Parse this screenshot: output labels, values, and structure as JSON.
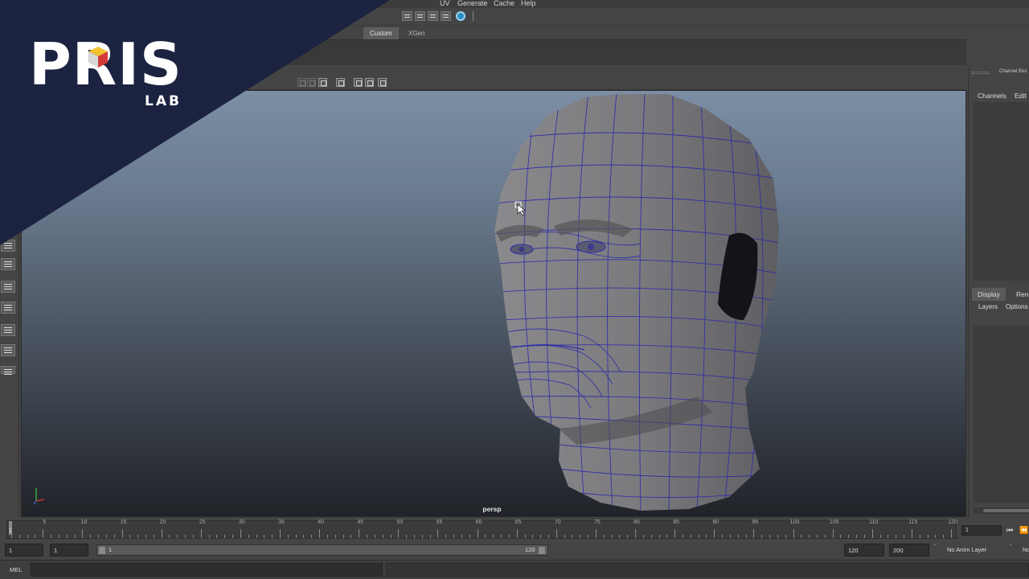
{
  "menu": [
    "UV",
    "Generate",
    "Cache",
    "Help"
  ],
  "shelf_tabs": [
    "Custom",
    "XGen"
  ],
  "shelf_active_tab": "Custom",
  "viewport": {
    "camera": "persp"
  },
  "channel_box": {
    "title": "Channel Box",
    "menus": [
      "Channels",
      "Edit"
    ]
  },
  "layer_editor": {
    "tabs": [
      "Display",
      "Rend"
    ],
    "menus": [
      "Layers",
      "Options"
    ]
  },
  "time_slider": {
    "ticks": [
      "5",
      "10",
      "15",
      "20",
      "25",
      "30",
      "35",
      "40",
      "45",
      "50",
      "55",
      "60",
      "65",
      "70",
      "75",
      "80",
      "85",
      "90",
      "95",
      "100",
      "105",
      "110",
      "115",
      "120"
    ],
    "current_frame": "1",
    "current_frame_field": "1"
  },
  "range_slider": {
    "start_time": "1",
    "range_start": "1",
    "range_bar_start": "1",
    "range_bar_end": "120",
    "range_end": "120",
    "end_time": "200",
    "anim_layer": "No Anim Layer",
    "char_set": "No"
  },
  "command_line": {
    "label": "MEL"
  },
  "logo": {
    "brand": "PRIS",
    "sub": "LAB"
  },
  "colors": {
    "logo_bg": "#1c2340",
    "viewport_top": "#7c8ea4",
    "viewport_bottom": "#202328",
    "wireframe": "#2a2aa0",
    "mesh_fill": "#7a7a7c"
  }
}
